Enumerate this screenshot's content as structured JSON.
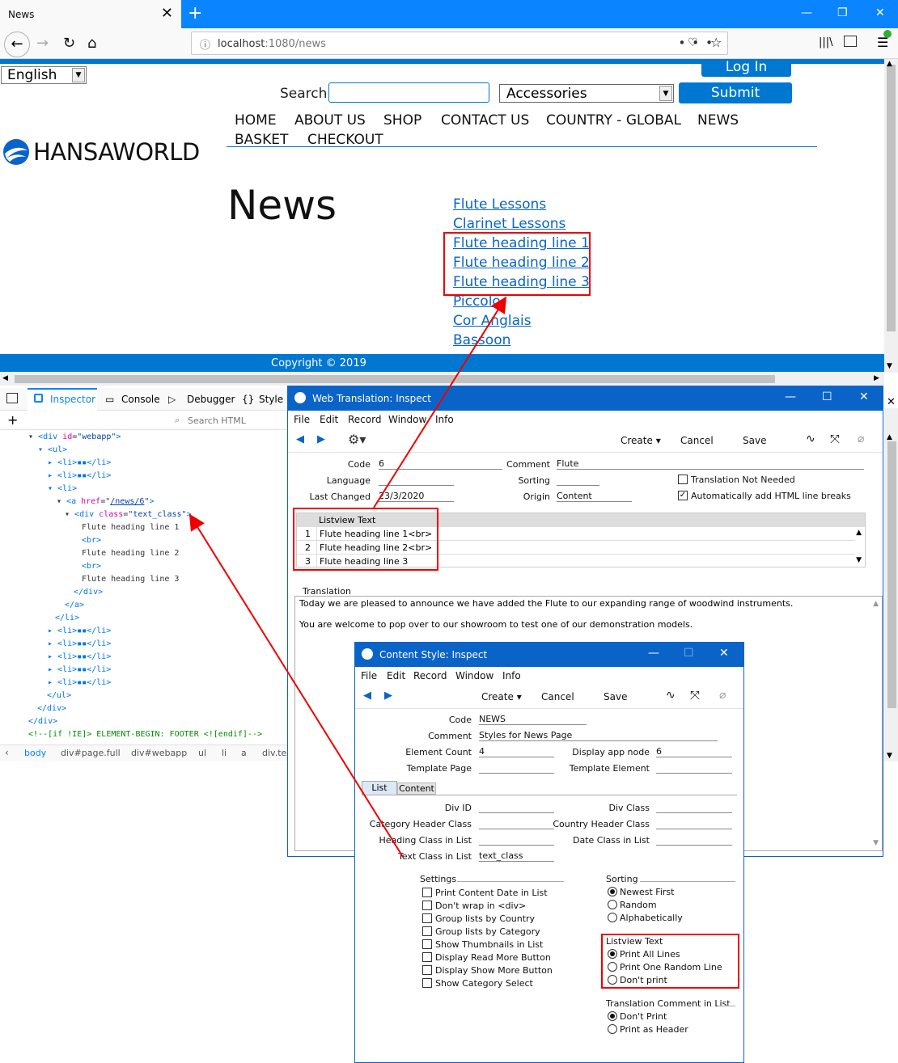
{
  "browser": {
    "tab_title": "News",
    "url_host": "localhost",
    "url_path": ":1080/news"
  },
  "site": {
    "language": "English",
    "login": "Log In",
    "search_label": "Search",
    "category": "Accessories",
    "submit": "Submit",
    "menu": [
      "HOME",
      "ABOUT US",
      "SHOP",
      "CONTACT US",
      "COUNTRY - GLOBAL",
      "NEWS",
      "BASKET",
      "CHECKOUT"
    ],
    "logo": "HANSAWORLD",
    "page_title": "News",
    "news_links": [
      "Flute Lessons",
      "Clarinet Lessons",
      "Flute heading line 1",
      "Flute heading line 2",
      "Flute heading line 3",
      "Piccolo",
      "Cor Anglais",
      "Bassoon"
    ],
    "copyright": "Copyright © 2019"
  },
  "devtools": {
    "tabs": [
      "Inspector",
      "Console",
      "Debugger",
      "Style E"
    ],
    "search_placeholder": "Search HTML",
    "breadcrumb": [
      "body",
      "div#page.full",
      "div#webapp",
      "ul",
      "li",
      "a",
      "div.tex"
    ],
    "code": {
      "l1_tag": "div",
      "l1_attr": "id",
      "l1_val": "\"webapp\"",
      "ul": "<ul>",
      "li_open": "<li>",
      "li_collapsed": "</li>",
      "a_attr": "href",
      "a_val": "/news/6",
      "div_attr": "class",
      "div_val": "\"text_class\"",
      "text1": "Flute heading line 1",
      "br": "<br>",
      "text2": "Flute heading line 2",
      "text3": "Flute heading line 3",
      "close_div": "</div>",
      "close_a": "</a>",
      "close_li": "</li>",
      "close_ul": "</ul>",
      "comment": "<!--[if !IE]> ELEMENT-BEGIN: FOOTER <![endif]-->"
    }
  },
  "web_translation": {
    "title": "Web Translation: Inspect",
    "menu": [
      "File",
      "Edit",
      "Record",
      "Window",
      "Info"
    ],
    "toolbar": {
      "create": "Create",
      "cancel": "Cancel",
      "save": "Save"
    },
    "code_label": "Code",
    "code_value": "6",
    "comment_label": "Comment",
    "comment_value": "Flute",
    "language_label": "Language",
    "sorting_label": "Sorting",
    "last_changed_label": "Last Changed",
    "last_changed_value": "23/3/2020",
    "origin_label": "Origin",
    "origin_value": "Content",
    "translation_not_needed": "Translation Not Needed",
    "auto_html_breaks": "Automatically add HTML line breaks",
    "listview_header": "Listview Text",
    "listview_rows": [
      {
        "n": "1",
        "text": "Flute heading line 1<br>"
      },
      {
        "n": "2",
        "text": "Flute heading line 2<br>"
      },
      {
        "n": "3",
        "text": "Flute heading line 3"
      }
    ],
    "translation_label": "Translation",
    "translation_p1": "Today we are pleased to announce we have added the Flute to our expanding range of woodwind instruments.",
    "translation_p2": "You are welcome to pop over to our showroom to test one of our demonstration models."
  },
  "content_style": {
    "title": "Content Style: Inspect",
    "menu": [
      "File",
      "Edit",
      "Record",
      "Window",
      "Info"
    ],
    "toolbar": {
      "create": "Create",
      "cancel": "Cancel",
      "save": "Save"
    },
    "code_label": "Code",
    "code_value": "NEWS",
    "comment_label": "Comment",
    "comment_value": "Styles for News Page",
    "element_count_label": "Element Count",
    "element_count_value": "4",
    "display_app_node_label": "Display app node",
    "display_app_node_value": "6",
    "template_page_label": "Template Page",
    "template_element_label": "Template Element",
    "tabs": [
      "List",
      "Content"
    ],
    "div_id_label": "Div ID",
    "div_class_label": "Div Class",
    "category_header_label": "Category Header Class",
    "country_header_label": "Country Header Class",
    "heading_class_label": "Heading Class in List",
    "date_class_label": "Date Class in List",
    "text_class_label": "Text Class in List",
    "text_class_value": "text_class",
    "settings_title": "Settings",
    "settings": [
      "Print Content Date in List",
      "Don't wrap in <div>",
      "Group lists by Country",
      "Group lists by Category",
      "Show Thumbnails in List",
      "Display Read More Button",
      "Display Show More Button",
      "Show Category Select"
    ],
    "sorting_title": "Sorting",
    "sorting": [
      "Newest First",
      "Random",
      "Alphabetically"
    ],
    "sorting_selected": 0,
    "listview_title": "Listview Text",
    "listview": [
      "Print All Lines",
      "Print One Random Line",
      "Don't print"
    ],
    "listview_selected": 0,
    "translation_comment_title": "Translation Comment in List",
    "translation_comment": [
      "Don't Print",
      "Print as Header"
    ],
    "translation_comment_selected": 0
  },
  "colors": {
    "brand_blue": "#0077d0",
    "firefox_blue": "#0a84ff",
    "window_blue": "#0a64c8",
    "annotation_red": "#e00000"
  }
}
